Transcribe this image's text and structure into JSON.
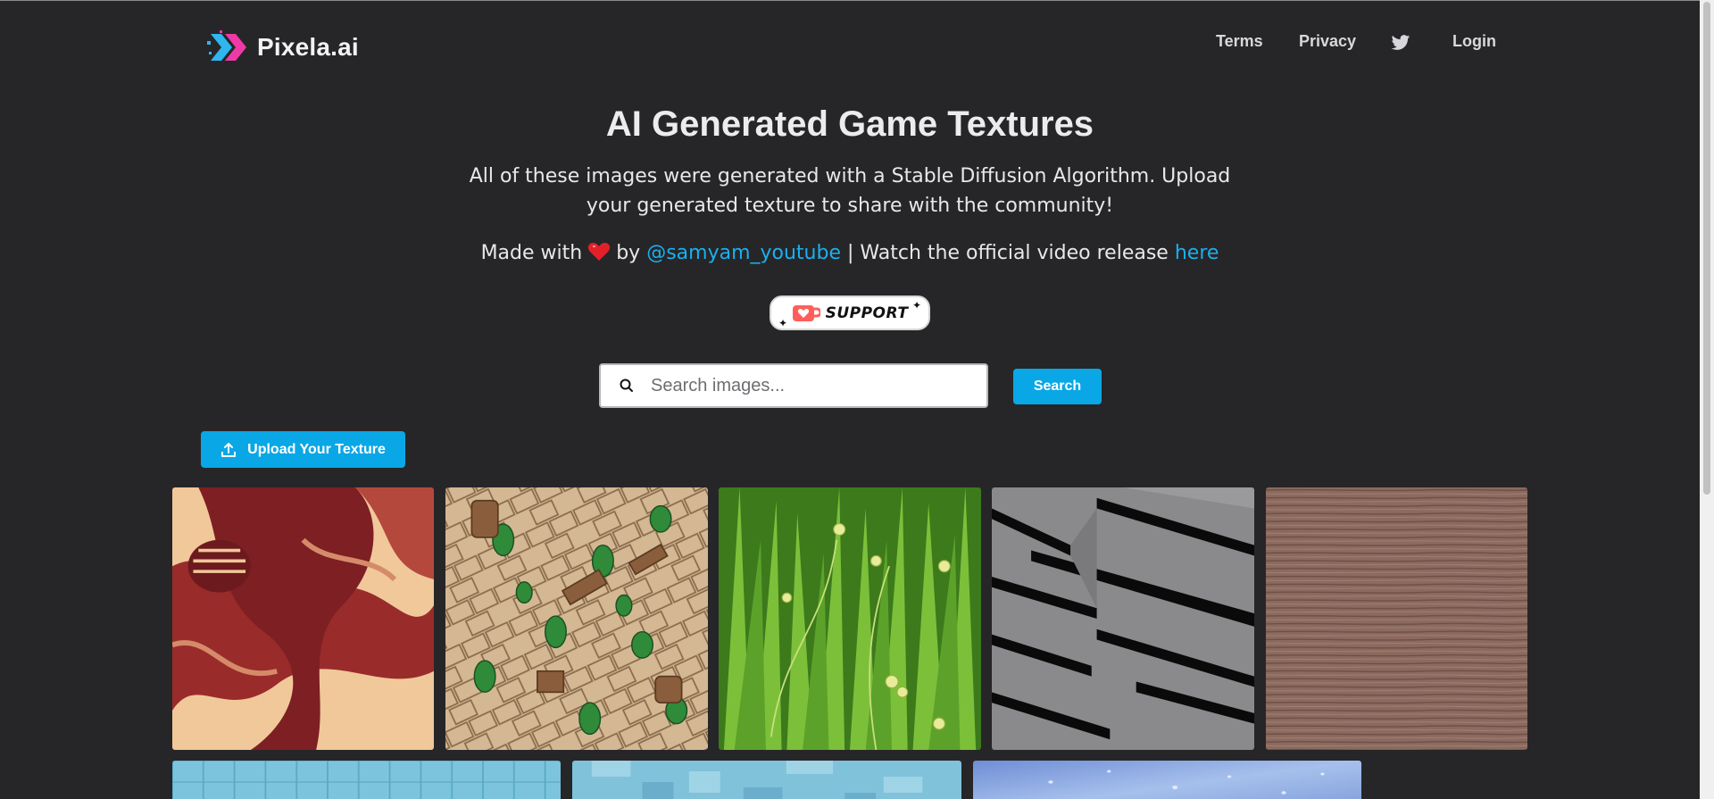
{
  "header": {
    "brand": "Pixela.ai",
    "nav": {
      "terms": "Terms",
      "privacy": "Privacy",
      "login": "Login",
      "twitter_icon": "twitter-icon"
    }
  },
  "hero": {
    "title": "AI Generated Game Textures",
    "description": "All of these images were generated with a Stable Diffusion Algorithm. Upload your generated texture to share with the community!",
    "made_prefix": "Made with",
    "made_by": "by",
    "author": "@samyam_youtube",
    "separator": "| Watch the official video release",
    "here": "here"
  },
  "support": {
    "label": "SUPPORT"
  },
  "search": {
    "placeholder": "Search images...",
    "value": "",
    "button": "Search"
  },
  "upload": {
    "label": "Upload Your Texture"
  },
  "gallery": [
    {
      "name": "red-tree-texture"
    },
    {
      "name": "stone-leaf-texture"
    },
    {
      "name": "grass-texture"
    },
    {
      "name": "metal-slat-texture"
    },
    {
      "name": "brown-wood-texture"
    },
    {
      "name": "blue-tile-texture"
    },
    {
      "name": "blue-pixel-texture"
    },
    {
      "name": "blue-water-texture"
    }
  ],
  "colors": {
    "background": "#262628",
    "accent": "#0aa7e6",
    "link": "#1ab0f0",
    "heart": "#e3202a"
  }
}
